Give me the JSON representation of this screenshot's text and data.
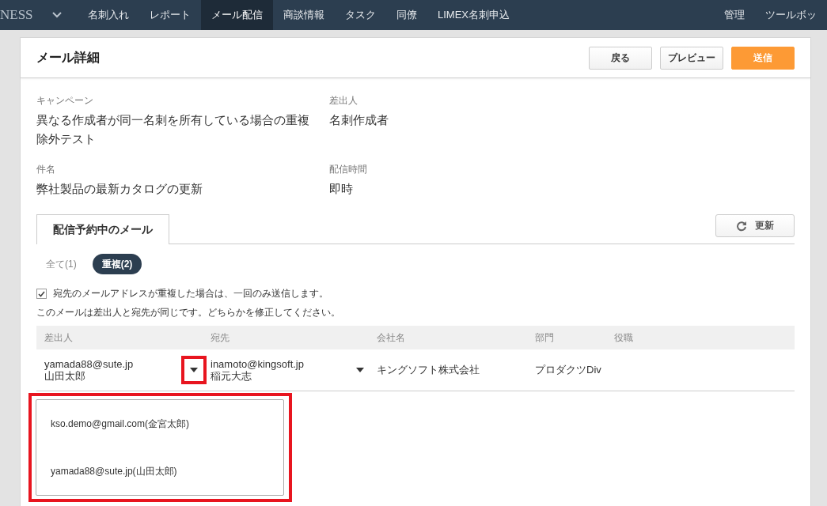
{
  "nav": {
    "brand": "NESS",
    "items": [
      {
        "label": "名刺入れ",
        "selected": false
      },
      {
        "label": "レポート",
        "selected": false
      },
      {
        "label": "メール配信",
        "selected": true
      },
      {
        "label": "商談情報",
        "selected": false
      },
      {
        "label": "タスク",
        "selected": false
      },
      {
        "label": "同僚",
        "selected": false
      },
      {
        "label": "LIMEX名刺申込",
        "selected": false
      }
    ],
    "right_items": [
      "管理",
      "ツールボッ"
    ]
  },
  "page": {
    "title": "メール詳細",
    "buttons": [
      {
        "label": "戻る",
        "kind": "default"
      },
      {
        "label": "プレビュー",
        "kind": "default"
      },
      {
        "label": "送信",
        "kind": "primary"
      }
    ]
  },
  "fields": [
    {
      "label": "キャンペーン",
      "value": "異なる作成者が同一名刺を所有している場合の重複除外テスト"
    },
    {
      "label": "差出人",
      "value": "名刺作成者"
    },
    {
      "label": "件名",
      "value": "弊社製品の最新カタログの更新"
    },
    {
      "label": "配信時間",
      "value": "即時"
    }
  ],
  "tabs": [
    {
      "label": "配信予約中のメール",
      "selected": true
    }
  ],
  "refresh_button": "更新",
  "filters": [
    {
      "label": "全て(1)",
      "selected": false
    },
    {
      "label": "重複(2)",
      "selected": true
    }
  ],
  "dedupe": {
    "label": "宛先のメールアドレスが重複した場合は、一回のみ送信します。",
    "checked": true
  },
  "warning": "このメールは差出人と宛先が同じです。どちらかを修正してください。",
  "table": {
    "columns": [
      "差出人",
      "宛先",
      "会社名",
      "部門",
      "役職"
    ],
    "rows": [
      {
        "sender_email": "yamada88@sute.jp",
        "sender_name": "山田太郎",
        "recipient_email": "inamoto@kingsoft.jp",
        "recipient_name": "稲元大志",
        "company": "キングソフト株式会社",
        "department": "プロダクツDiv"
      }
    ]
  },
  "sender_menu": {
    "expanded": true,
    "highlighted": true,
    "options": [
      "kso.demo@gmail.com(金宮太郎)",
      "yamada88@sute.jp(山田太郎)"
    ]
  }
}
